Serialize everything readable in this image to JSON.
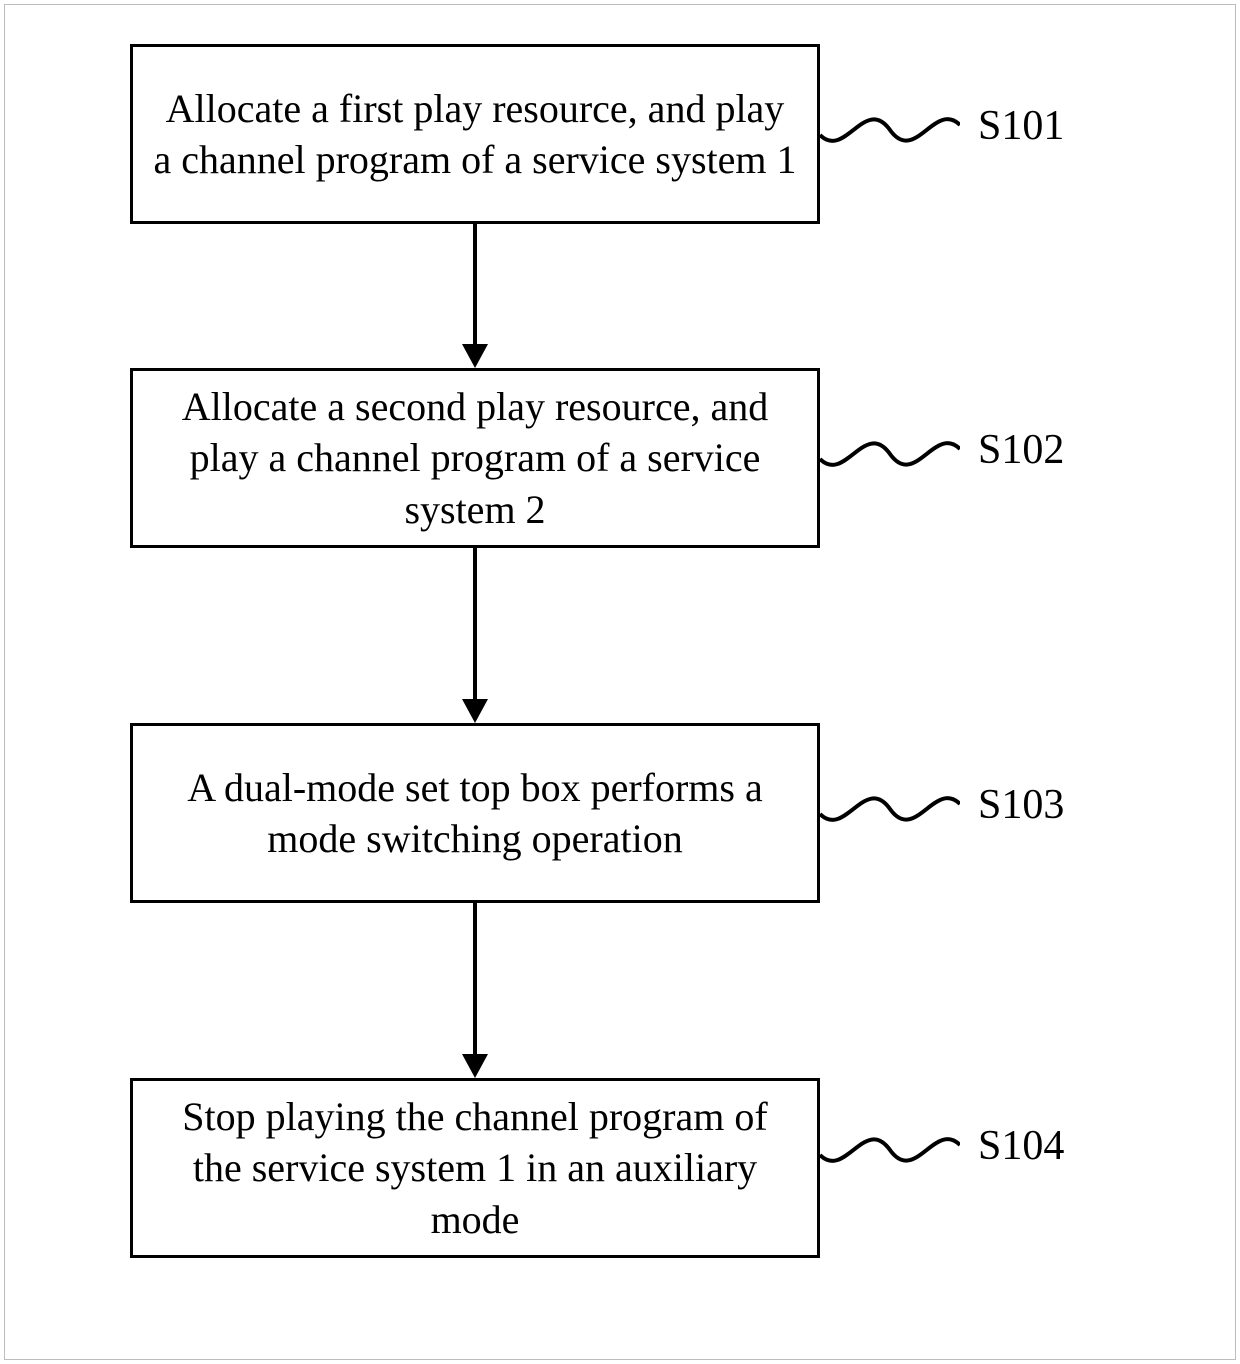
{
  "diagram": {
    "type": "flowchart",
    "orientation": "vertical",
    "steps": [
      {
        "id": "S101",
        "text": "Allocate a first play resource, and play a channel program of a service system 1"
      },
      {
        "id": "S102",
        "text": "Allocate a second play resource, and play a channel program of a service system 2"
      },
      {
        "id": "S103",
        "text": "A dual-mode set top box performs a mode switching operation"
      },
      {
        "id": "S104",
        "text": "Stop playing the channel program of the service system 1 in an auxiliary mode"
      }
    ],
    "edges": [
      {
        "from": "S101",
        "to": "S102"
      },
      {
        "from": "S102",
        "to": "S103"
      },
      {
        "from": "S103",
        "to": "S104"
      }
    ]
  }
}
